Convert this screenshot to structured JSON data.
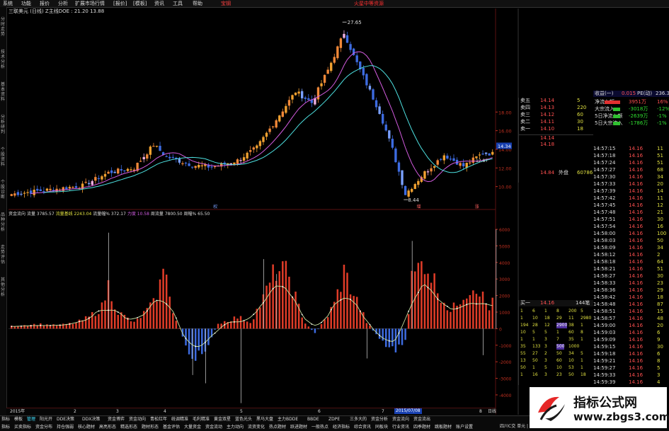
{
  "menu": [
    "系统",
    "功能",
    "报价",
    "分析",
    "扩展市场行情",
    "资讯",
    "工具",
    "帮助"
  ],
  "menu_extra": [
    "[报价]",
    "[模板]"
  ],
  "menu_red": "宝钢",
  "menu_right": "火星中等资源",
  "header_left": "三联美元 (日线)   Z主线DOE : 21.20  13.88",
  "left_tabs": [
    "分时走势",
    "技术分析",
    "基本资料",
    "分析研判",
    "个股资料",
    "个股诊断",
    "品种分析",
    "走势评估",
    "其他分析"
  ],
  "price_labels": {
    "peak": "27.65",
    "low": "8.44",
    "axis": [
      "18.00",
      "16.00",
      "14.00",
      "12.00",
      "10.00"
    ],
    "current": "14.34",
    "current_box": "12.87"
  },
  "price_markers": [
    "权",
    "增",
    "涨"
  ],
  "indicator_header": {
    "title": "资金流向",
    "a_label": "流量",
    "a_value": "3785.57",
    "b_label": "流量基线",
    "b_value": "2243.04",
    "c_label": "流量幅%",
    "c_value": "372.17",
    "d_label": "力度",
    "d_value": "10.58",
    "e_label": "周流量",
    "e_value": "7800.50",
    "f_label": "周幅%",
    "f_value": "65.50"
  },
  "indicator_axis": [
    "6000",
    "5000",
    "4000",
    "3000",
    "2000",
    "1000",
    "0",
    "-1000",
    "-2000",
    "-3000",
    "-4000"
  ],
  "date_bar": {
    "left": "2015年",
    "ticks": [
      "2",
      "3",
      "4",
      "5",
      "6",
      "7",
      "8"
    ],
    "highlight": "2015/07/08",
    "right": "日线"
  },
  "tabs_row1": [
    "指标",
    "模板",
    "管理",
    "阳光开",
    "DDE决策",
    "DDX决策",
    "资金博弈",
    "资金动向",
    "青松红年",
    "统调精准",
    "毛利精准",
    "黄金双星",
    "蓝色光头",
    "黑马大盘",
    "主力BDDE",
    "BBDE",
    "ZDPE",
    "三多大的",
    "资金分析",
    "资金流向",
    "资金流出"
  ],
  "tabs_row2": [
    "指标",
    "买卖指标",
    "资金分布",
    "持仓强弱",
    "核心题材",
    "高亮形态",
    "精选形态",
    "题材形态",
    "基金评估",
    "大量资金",
    "资金流动",
    "主力动向",
    "流资变化",
    "热点题材",
    "跃进题材",
    "一般热点",
    "经济指标",
    "综合资讯",
    "同板块",
    "行业资讯",
    "四季题材",
    "跳板题材",
    "账户设置"
  ],
  "right_top": [
    "价/新",
    "今/开",
    "最高",
    "最低",
    "总量",
    "总额"
  ],
  "buy_sell": {
    "sell_labels": [
      "卖五",
      "卖四",
      "卖三",
      "卖二",
      "卖一"
    ],
    "buy_labels": [
      "买一",
      "买二",
      "买三",
      "买四",
      "买五"
    ],
    "price_a": "14.14",
    "price_b": "14.18",
    "sell_prices": [
      "14.14",
      "14.13",
      "14.12",
      "14.11",
      "14.10"
    ],
    "buy_prices": [
      "14.09",
      "14.08",
      "14.06",
      "14.05",
      "14.00"
    ],
    "sell_vols": [
      "5",
      "220",
      "60",
      "30",
      "18"
    ],
    "buy_vols": [
      "21",
      "2",
      "59",
      "72",
      "15"
    ],
    "outer": "14.84",
    "outer_label": "外盘",
    "inner_label": "内盘",
    "inner": "60786"
  },
  "flow": {
    "title_left": "收益(一)",
    "title_mid": "0.015",
    "title_pe": "PE(动)",
    "title_right": "236.3",
    "rows": [
      {
        "label": "净流入额",
        "value": "3951万",
        "pct": "16%"
      },
      {
        "label": "大宗流入",
        "value": "-3018万",
        "pct": "-12%"
      },
      {
        "label": "5日净流入额",
        "value": "-2639万",
        "pct": "-1%"
      },
      {
        "label": "5日大宗流入",
        "value": "-1786万",
        "pct": "-1%"
      }
    ]
  },
  "ticks": [
    {
      "t": "14:57:15",
      "p": "14.16",
      "v": "11"
    },
    {
      "t": "14:57:18",
      "p": "14.16",
      "v": "51"
    },
    {
      "t": "14:57:24",
      "p": "14.16",
      "v": "51"
    },
    {
      "t": "14:57:27",
      "p": "14.16",
      "v": "68"
    },
    {
      "t": "14:57:30",
      "p": "14.16",
      "v": "34"
    },
    {
      "t": "14:57:33",
      "p": "14.16",
      "v": "20"
    },
    {
      "t": "14:57:39",
      "p": "14.16",
      "v": "14"
    },
    {
      "t": "14:57:42",
      "p": "14.16",
      "v": "11"
    },
    {
      "t": "14:57:45",
      "p": "14.16",
      "v": "12"
    },
    {
      "t": "14:57:48",
      "p": "14.16",
      "v": "21"
    },
    {
      "t": "14:57:51",
      "p": "14.16",
      "v": "30"
    },
    {
      "t": "14:57:54",
      "p": "14.16",
      "v": "16"
    },
    {
      "t": "14:58:00",
      "p": "14.16",
      "v": "100"
    },
    {
      "t": "14:58:03",
      "p": "14.16",
      "v": "50"
    },
    {
      "t": "14:58:09",
      "p": "14.16",
      "v": "34"
    },
    {
      "t": "14:58:12",
      "p": "14.16",
      "v": "2"
    },
    {
      "t": "14:58:18",
      "p": "14.16",
      "v": "64"
    },
    {
      "t": "14:58:21",
      "p": "14.16",
      "v": "51"
    },
    {
      "t": "14:58:27",
      "p": "14.16",
      "v": "30"
    },
    {
      "t": "14:58:33",
      "p": "14.16",
      "v": "23"
    },
    {
      "t": "14:58:36",
      "p": "14.16",
      "v": "29"
    },
    {
      "t": "14:58:42",
      "p": "14.16",
      "v": "18"
    },
    {
      "t": "14:58:48",
      "p": "14.16",
      "v": "87"
    },
    {
      "t": "14:58:51",
      "p": "14.16",
      "v": "15"
    },
    {
      "t": "14:58:57",
      "p": "14.16",
      "v": "48"
    },
    {
      "t": "14:59:00",
      "p": "14.16",
      "v": "20"
    },
    {
      "t": "14:59:03",
      "p": "14.16",
      "v": "6"
    },
    {
      "t": "14:59:09",
      "p": "14.16",
      "v": "9"
    },
    {
      "t": "14:59:15",
      "p": "14.16",
      "v": "30"
    },
    {
      "t": "14:59:18",
      "p": "14.16",
      "v": "6"
    },
    {
      "t": "14:59:21",
      "p": "14.16",
      "v": "8"
    },
    {
      "t": "14:59:27",
      "p": "14.16",
      "v": "5"
    },
    {
      "t": "14:59:33",
      "p": "14.16",
      "v": "3"
    },
    {
      "t": "14:59:39",
      "p": "14.16",
      "v": "4"
    },
    {
      "t": "14:59:45",
      "p": "14.16",
      "v": "3"
    },
    {
      "t": "14:59:48",
      "p": "14.16",
      "v": "6"
    }
  ],
  "queue": {
    "header_left": "买一",
    "header_price": "14.16",
    "header_right": "144笔",
    "rows": [
      [
        "1",
        "6",
        "1",
        "8",
        "200",
        "5"
      ],
      [
        "1",
        "10",
        "18",
        "29",
        "11",
        "2980"
      ],
      [
        "194",
        "28",
        "12",
        "2900",
        "38",
        "1"
      ],
      [
        "10",
        "5",
        "5",
        "1",
        "60",
        "8"
      ],
      [
        "1",
        "1",
        "3",
        "7",
        "35",
        "1"
      ],
      [
        "35",
        "133",
        "3",
        "500",
        "1000",
        ""
      ],
      [
        "55",
        "27",
        "2",
        "50",
        "34",
        "5"
      ],
      [
        "13",
        "50",
        "3",
        "60",
        "10",
        "1"
      ],
      [
        "50",
        "1",
        "5",
        "10",
        "53",
        "1"
      ],
      [
        "1",
        "16",
        "3",
        "23",
        "50",
        "18"
      ]
    ]
  },
  "status_right": "四川C交  单元  |  自",
  "watermark": {
    "line1": "指标公式网",
    "line2": "www.zbgs3.com"
  },
  "colors": {
    "up": "#e03c28",
    "down": "#3d6be0",
    "orange": "#f0a030",
    "ma1": "#d45ce0",
    "ma2": "#4de0e0",
    "line": "#dcdcdc",
    "axis": "#c03020"
  }
}
